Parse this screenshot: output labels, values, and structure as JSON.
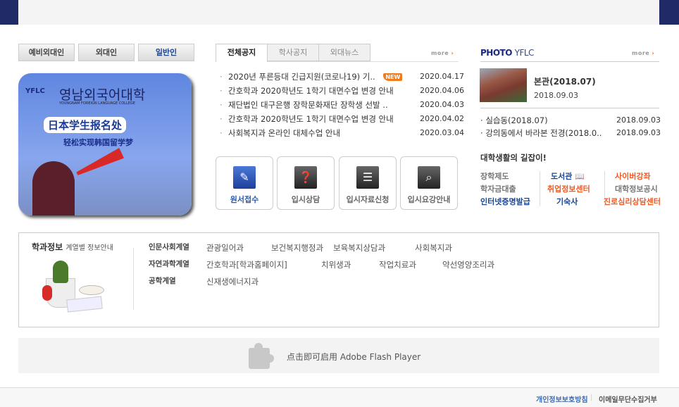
{
  "user_buttons": [
    "예비외대인",
    "외대인",
    "일반인"
  ],
  "banner": {
    "logo": "YFLC",
    "title": "영남외국어대학",
    "subtitle": "YOUNGNAM FOREIGN LANGUAGE COLLEGE",
    "headline": "日本学生报名处",
    "tagline": "轻松实现韩国留学梦"
  },
  "notice": {
    "tabs": [
      "전체공지",
      "학사공지",
      "외대뉴스"
    ],
    "more": "more",
    "new_badge": "NEW",
    "items": [
      {
        "title": "2020년 푸른등대 긴급지원(코로나19) 기..",
        "date": "2020.04.17",
        "new": true
      },
      {
        "title": "간호학과 2020학년도 1학기 대면수업 변경 안내",
        "date": "2020.04.06"
      },
      {
        "title": "재단법인 대구은행 장학문화재단 장학생 선발 ..",
        "date": "2020.04.03"
      },
      {
        "title": "간호학과 2020학년도 1학기 대면수업 변경 안내",
        "date": "2020.04.02"
      },
      {
        "title": "사회복지과 온라인 대체수업 안내",
        "date": "2020.03.04"
      }
    ]
  },
  "quick": [
    {
      "label": "원서접수",
      "icon": "pencil-icon"
    },
    {
      "label": "입시상담",
      "icon": "consult-icon"
    },
    {
      "label": "입시자료신청",
      "icon": "document-icon"
    },
    {
      "label": "입시요강안내",
      "icon": "search-screen-icon"
    }
  ],
  "photo": {
    "title_a": "PHOTO",
    "title_b": "YFLC",
    "more": "more",
    "featured": {
      "caption": "본관(2018.07)",
      "date": "2018.09.03"
    },
    "items": [
      {
        "title": "실습동(2018.07)",
        "date": "2018.09.03"
      },
      {
        "title": "강의동에서 바라본 전경(2018.0..",
        "date": "2018.09.03"
      }
    ]
  },
  "guide": {
    "title": "대학생활의 길잡이!",
    "col1": [
      "장학제도",
      "학자금대출",
      "인터넷증명발급"
    ],
    "col2": [
      "도서관",
      "취업정보센터",
      "기숙사"
    ],
    "col3": [
      "사이버강좌",
      "대학정보공시",
      "진로심리상담센터"
    ]
  },
  "dept": {
    "title": "학과정보",
    "subtitle": "계열별 정보안내",
    "categories": [
      {
        "name": "인문사회계열",
        "items": [
          "관광일어과",
          "보건복지행정과",
          "보육복지상담과",
          "사회복지과"
        ]
      },
      {
        "name": "자연과학계열",
        "items": [
          "간호학과[학과홈페이지]",
          "치위생과",
          "작업치료과",
          "약선영양조리과"
        ]
      },
      {
        "name": "공학계열",
        "items": [
          "신재생에너지과"
        ]
      }
    ]
  },
  "flash": {
    "text": "点击即可启用 Adobe Flash Player"
  },
  "footer": {
    "privacy": "개인정보보호방침",
    "sep": "|",
    "email": "이메일무단수집거부"
  },
  "colors": {
    "navy": "#1f2a66",
    "accent_blue": "#1d4590",
    "orange": "#ee5a24"
  }
}
